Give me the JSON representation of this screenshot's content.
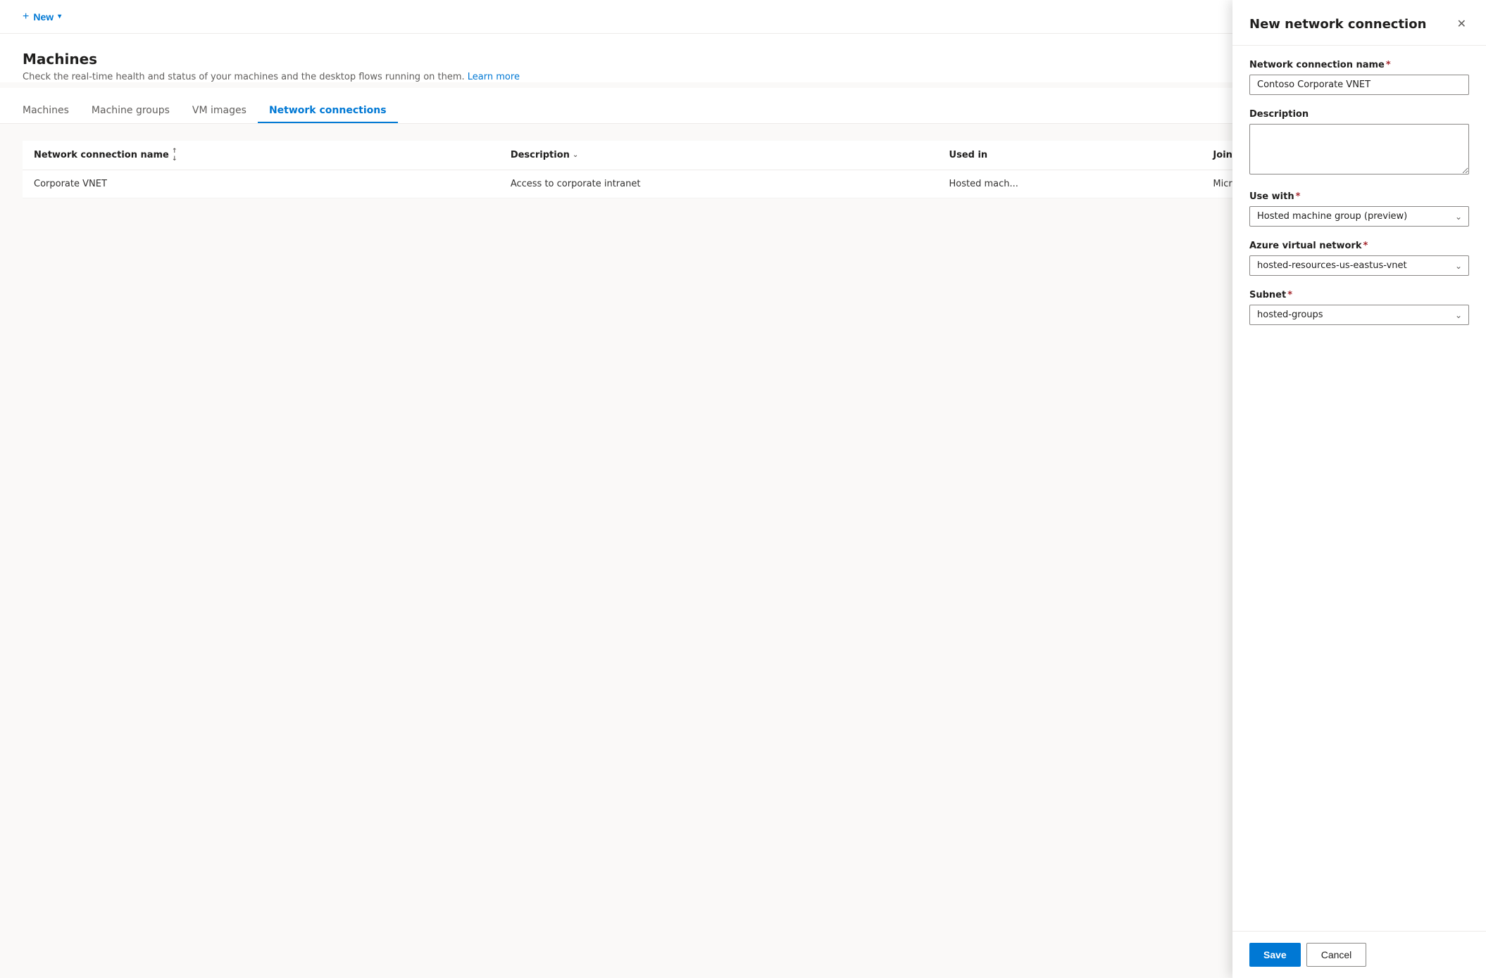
{
  "topbar": {
    "new_label": "New",
    "new_icon": "+",
    "chevron_icon": "▾"
  },
  "page": {
    "title": "Machines",
    "subtitle": "Check the real-time health and status of your machines and the desktop flows running on them.",
    "learn_more": "Learn more"
  },
  "tabs": [
    {
      "id": "machines",
      "label": "Machines",
      "active": false
    },
    {
      "id": "machine-groups",
      "label": "Machine groups",
      "active": false
    },
    {
      "id": "vm-images",
      "label": "VM images",
      "active": false
    },
    {
      "id": "network-connections",
      "label": "Network connections",
      "active": true
    }
  ],
  "table": {
    "columns": [
      {
        "id": "name",
        "label": "Network connection name",
        "sortable": true
      },
      {
        "id": "description",
        "label": "Description",
        "filterable": true
      },
      {
        "id": "used_in",
        "label": "Used in"
      },
      {
        "id": "join_type",
        "label": "Join type"
      }
    ],
    "rows": [
      {
        "name": "Corporate VNET",
        "description": "Access to corporate intranet",
        "used_in": "Hosted mach...",
        "join_type": "Microsoft Ent..."
      }
    ]
  },
  "panel": {
    "title": "New network connection",
    "close_icon": "✕",
    "fields": {
      "connection_name_label": "Network connection name",
      "connection_name_value": "Contoso Corporate VNET",
      "description_label": "Description",
      "description_value": "",
      "use_with_label": "Use with",
      "use_with_value": "Hosted machine group (preview)",
      "use_with_options": [
        "Hosted machine group (preview)"
      ],
      "azure_vnet_label": "Azure virtual network",
      "azure_vnet_value": "hosted-resources-us-eastus-vnet",
      "azure_vnet_options": [
        "hosted-resources-us-eastus-vnet"
      ],
      "subnet_label": "Subnet",
      "subnet_value": "hosted-groups",
      "subnet_options": [
        "hosted-groups"
      ]
    },
    "save_label": "Save",
    "cancel_label": "Cancel",
    "chevron_icon": "⌄"
  }
}
